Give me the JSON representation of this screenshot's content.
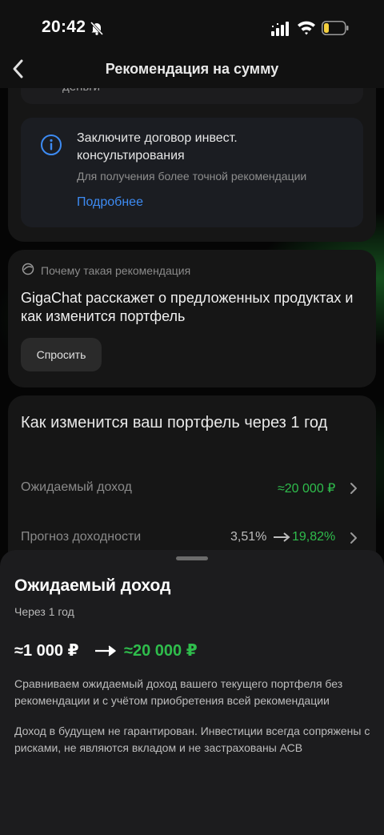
{
  "status_bar": {
    "time": "20:42"
  },
  "header": {
    "title": "Рекомендация на сумму"
  },
  "previous_item": {
    "text": "деньги"
  },
  "info_card": {
    "title": "Заключите договор инвест. консультирования",
    "subtitle": "Для получения более точной рекомендации",
    "link": "Подробнее"
  },
  "gigachat_card": {
    "small_label": "Почему такая рекомендация",
    "title": "GigaChat расскажет о предложенных продуктах и как изменится портфель",
    "button": "Спросить"
  },
  "portfolio_card": {
    "title": "Как изменится ваш портфель через 1 год",
    "rows": [
      {
        "label": "Ожидаемый доход",
        "value": "≈20 000 ₽"
      },
      {
        "label": "Прогноз доходности",
        "value_from": "3,51%",
        "value_to": "19,82%"
      }
    ]
  },
  "sheet": {
    "title": "Ожидаемый доход",
    "subtitle": "Через 1 год",
    "amount_from": "≈1 000 ₽",
    "amount_to": "≈20 000 ₽",
    "paragraph1": "Сравниваем ожидаемый доход вашего текущего портфеля без рекомендации и с учётом приобретения всей рекомендации",
    "paragraph2": "Доход в будущем не гарантирован. Инвестиции всегда сопряжены с рисками, не являются вкладом и не застрахованы АСВ"
  },
  "colors": {
    "accent_green": "#2fbd4c",
    "link_blue": "#3d8bf3",
    "background": "#050505"
  },
  "icons": [
    "bell-slash-icon",
    "signal-icon",
    "wifi-icon",
    "battery-icon",
    "back-arrow-icon",
    "info-icon",
    "gigachat-icon",
    "chevron-right-icon",
    "arrow-right-icon"
  ]
}
